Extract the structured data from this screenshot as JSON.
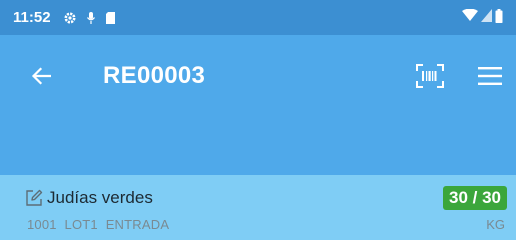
{
  "status_bar": {
    "time": "11:52",
    "icons": [
      "gear-icon",
      "mic-icon",
      "sd-card-icon"
    ],
    "right_icons": [
      "wifi-icon",
      "signal-icon",
      "battery-icon"
    ]
  },
  "app_bar": {
    "title": "RE00003",
    "back_icon": "arrow-left-icon",
    "scan_icon": "barcode-scan-icon",
    "menu_icon": "hamburger-menu-icon"
  },
  "items": [
    {
      "name": "Judías verdes",
      "code": "1001",
      "lot": "LOT1",
      "type": "ENTRADA",
      "quantity": "30 / 30",
      "unit": "KG"
    }
  ],
  "colors": {
    "status_bar": "#3c8fd2",
    "app_bar": "#4fa9ea",
    "item_row": "#7fcdf5",
    "badge": "#3ba63b"
  }
}
